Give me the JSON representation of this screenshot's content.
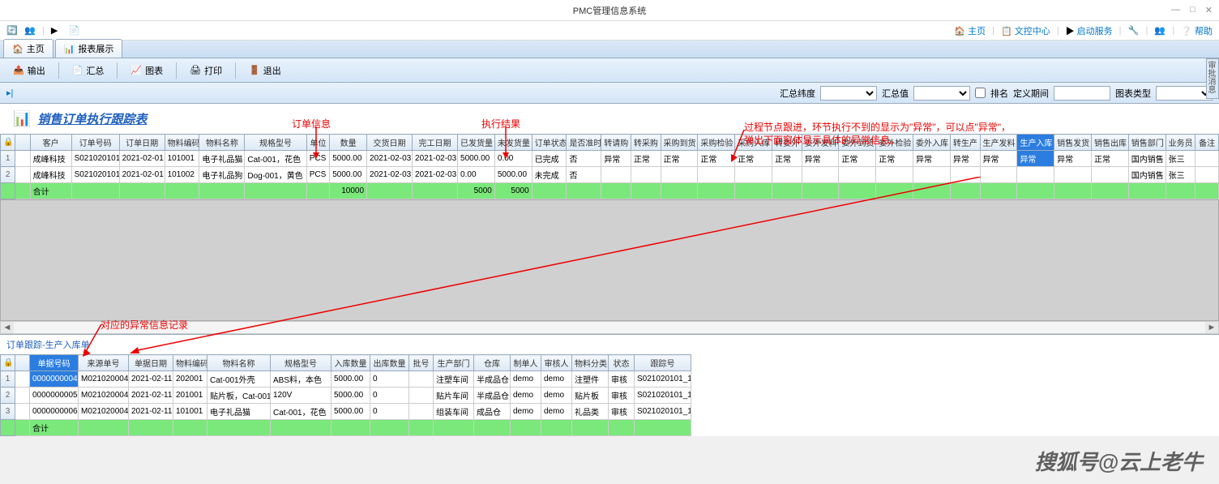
{
  "window": {
    "title": "PMC管理信息系统",
    "min": "—",
    "max": "□",
    "close": "✕"
  },
  "quick": {
    "home": "主页",
    "doc": "文控中心",
    "start": "启动服务",
    "help": "帮助"
  },
  "tabs": {
    "home": "主页",
    "report": "报表展示"
  },
  "toolbar": {
    "export": "输出",
    "summary": "汇总",
    "chart": "图表",
    "print": "打印",
    "exit": "退出"
  },
  "filter": {
    "dim": "汇总纬度",
    "val": "汇总值",
    "rank": "排名",
    "period": "定义期间",
    "chartType": "图表类型"
  },
  "report": {
    "title": "销售订单执行跟踪表"
  },
  "annotations": {
    "orderInfo": "订单信息",
    "execResult": "执行结果",
    "process": "过程节点跟进，环节执行不到的显示为\"异常\"，可以点\"异常\"，",
    "process2": "弹出下面窗体显示具体的异常信息。",
    "detail": "对应的异常信息记录"
  },
  "cols": [
    "",
    "客户",
    "订单号码",
    "订单日期",
    "物料编码",
    "物料名称",
    "规格型号",
    "单位",
    "数量",
    "交货日期",
    "完工日期",
    "已发货量",
    "未发货量",
    "订单状态",
    "是否准时",
    "转请购",
    "转采购",
    "采购到货",
    "采购检验",
    "采购入库",
    "转委外",
    "委外发料",
    "委外到货",
    "委外检验",
    "委外入库",
    "转生产",
    "生产发料",
    "生产入库",
    "销售发货",
    "销售出库",
    "销售部门",
    "业务员",
    "备注"
  ],
  "rows": [
    {
      "n": "1",
      "customer": "成峰科技",
      "order": "S021020101",
      "date": "2021-02-01",
      "mat": "101001",
      "name": "电子礼品猫",
      "spec": "Cat-001，花色",
      "unit": "PCS",
      "qty": "5000.00",
      "deliv": "2021-02-03",
      "finish": "2021-02-03",
      "shipped": "5000.00",
      "unship": "0.00",
      "status": "已完成",
      "ontime": "否",
      "c1": "异常",
      "c2": "正常",
      "c3": "正常",
      "c4": "正常",
      "c5": "正常",
      "c6": "正常",
      "c7": "异常",
      "c8": "正常",
      "c9": "正常",
      "c10": "异常",
      "c11": "异常",
      "c12": "异常",
      "c13": "异常",
      "c14": "异常",
      "c15": "正常",
      "dept": "国内销售",
      "sales": "张三"
    },
    {
      "n": "2",
      "customer": "成峰科技",
      "order": "S021020101",
      "date": "2021-02-01",
      "mat": "101002",
      "name": "电子礼品狗",
      "spec": "Dog-001，黄色",
      "unit": "PCS",
      "qty": "5000.00",
      "deliv": "2021-02-03",
      "finish": "2021-02-03",
      "shipped": "0.00",
      "unship": "5000.00",
      "status": "未完成",
      "ontime": "否",
      "dept": "国内销售",
      "sales": "张三"
    }
  ],
  "total": {
    "label": "合计",
    "qty": "10000",
    "shipped": "5000",
    "unship": "5000"
  },
  "bottom": {
    "title": "订单跟踪-生产入库单"
  },
  "bcols": [
    "",
    "单据号码",
    "来源单号",
    "单据日期",
    "物料编码",
    "物料名称",
    "规格型号",
    "入库数量",
    "出库数量",
    "批号",
    "生产部门",
    "仓库",
    "制单人",
    "审核人",
    "物料分类",
    "状态",
    "跟踪号"
  ],
  "brows": [
    {
      "n": "1",
      "doc": "0000000004",
      "src": "M021020004",
      "date": "2021-02-11",
      "mat": "202001",
      "name": "Cat-001外壳",
      "spec": "ABS料，本色",
      "in": "5000.00",
      "out": "0",
      "batch": "",
      "dept": "注塑车间",
      "wh": "半成品仓",
      "maker": "demo",
      "auditor": "demo",
      "cat": "注塑件",
      "status": "审核",
      "track": "S021020101_1"
    },
    {
      "n": "2",
      "doc": "0000000005",
      "src": "M021020004",
      "date": "2021-02-11",
      "mat": "201001",
      "name": "贴片板，Cat-001",
      "spec": "120V",
      "in": "5000.00",
      "out": "0",
      "batch": "",
      "dept": "贴片车间",
      "wh": "半成品仓",
      "maker": "demo",
      "auditor": "demo",
      "cat": "贴片板",
      "status": "审核",
      "track": "S021020101_1"
    },
    {
      "n": "3",
      "doc": "0000000006",
      "src": "M021020004",
      "date": "2021-02-11",
      "mat": "101001",
      "name": "电子礼品猫",
      "spec": "Cat-001，花色",
      "in": "5000.00",
      "out": "0",
      "batch": "",
      "dept": "组装车间",
      "wh": "成品仓",
      "maker": "demo",
      "auditor": "demo",
      "cat": "礼品类",
      "status": "审核",
      "track": "S021020101_1"
    }
  ],
  "btotal": {
    "label": "合计"
  },
  "watermark": "搜狐号@云上老牛",
  "sidepanel": "审批消息"
}
